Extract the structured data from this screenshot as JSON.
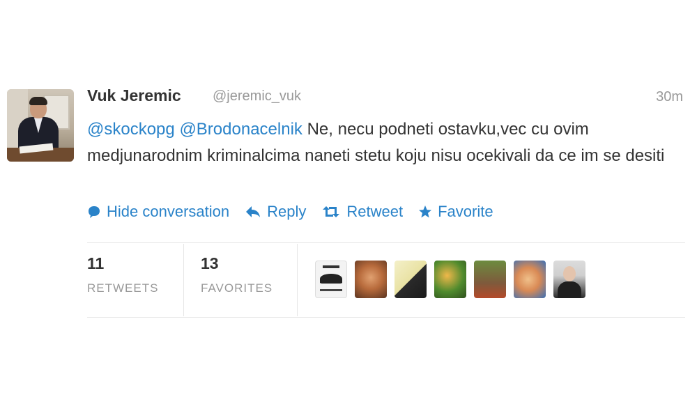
{
  "tweet": {
    "author_name": "Vuk Jeremic",
    "author_handle": "@jeremic_vuk",
    "timestamp": "30m",
    "mention_1": "@skockopg",
    "mention_2": "@Brodonacelnik",
    "body_text": " Ne, necu podneti ostavku,vec cu ovim medjunarodnim kriminalcima naneti stetu koju nisu ocekivali da ce im se desiti",
    "link_color": "#2a83c9"
  },
  "actions": {
    "hide_conversation": "Hide conversation",
    "reply": "Reply",
    "retweet": "Retweet",
    "favorite": "Favorite",
    "icons": [
      "speech-bubble-icon",
      "reply-arrow-icon",
      "retweet-icon",
      "star-icon"
    ]
  },
  "stats": {
    "retweets_count": "11",
    "retweets_label": "RETWEETS",
    "favorites_count": "13",
    "favorites_label": "FAVORITES"
  },
  "favoriters": {
    "avatars": [
      "avatar-1",
      "avatar-2",
      "avatar-3",
      "avatar-4",
      "avatar-5",
      "avatar-6",
      "avatar-7"
    ]
  }
}
